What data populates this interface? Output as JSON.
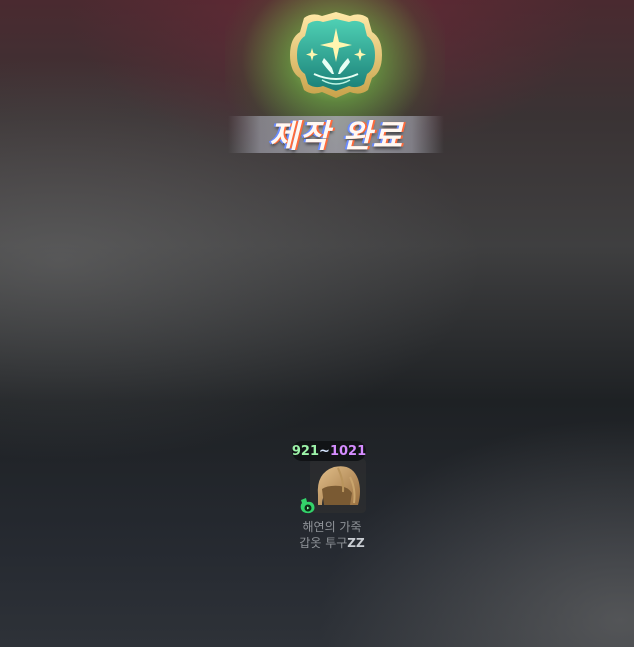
{
  "header": {
    "title": "제작 완료",
    "emblem_icon": "praying-hands-star-emblem-icon"
  },
  "result_item": {
    "level_min": "921",
    "level_sep": "~",
    "level_max": "1021",
    "icon": "leather-helmet-icon",
    "tier_icon": "green-tier-badge-icon",
    "name_line1": "해연의 가죽",
    "name_line2": "갑옷 투구",
    "name_suffix": "ZZ"
  },
  "colors": {
    "title_text": "#fff8f2",
    "level_min": "#9cf2a8",
    "level_max": "#d58cff",
    "name_text": "#8f9398"
  }
}
